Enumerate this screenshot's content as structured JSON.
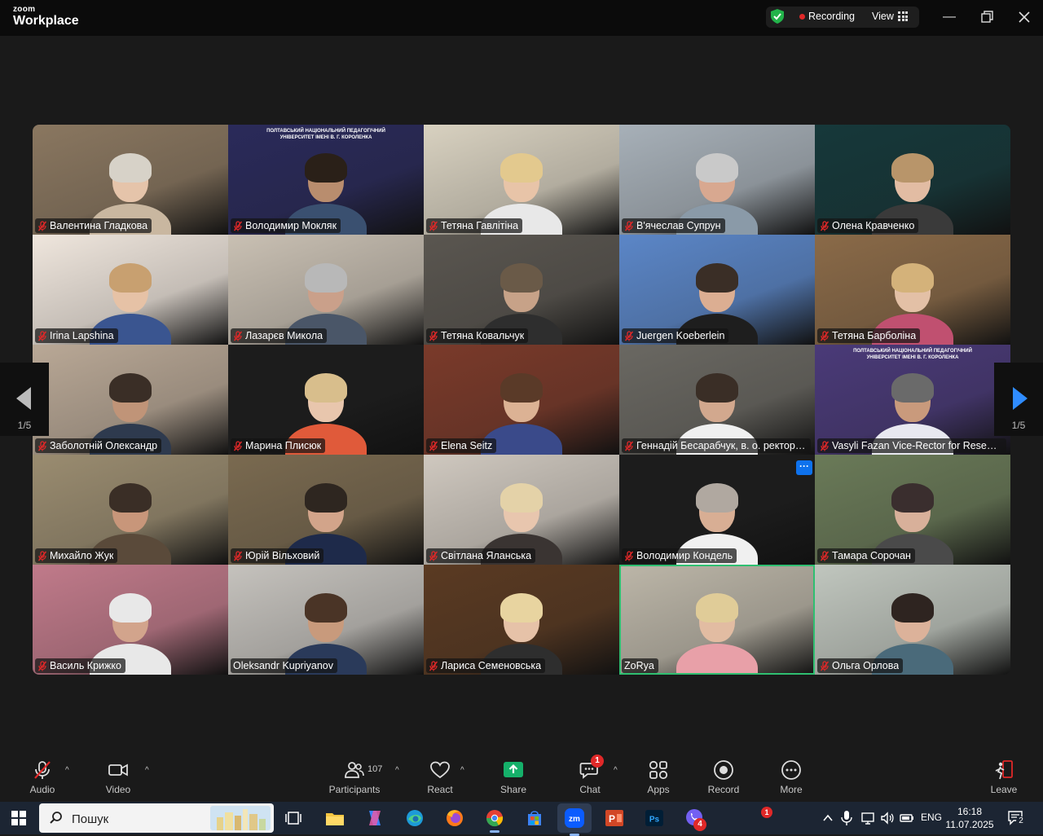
{
  "titlebar": {
    "brand_small": "zoom",
    "brand_big": "Workplace",
    "recording_label": "Recording",
    "view_label": "View"
  },
  "pager": {
    "left_page": "1/5",
    "right_page": "1/5"
  },
  "participants": [
    {
      "name": "Валентина Гладкова",
      "bg": "#8a7760",
      "skin": "#e5c4aa",
      "hair": "#d7d2c8",
      "shirt": "#c9b7a0",
      "muted": true
    },
    {
      "name": "Володимир Мокляк",
      "bg": "#2a2a5a",
      "skin": "#b98d6e",
      "hair": "#2a2018",
      "shirt": "#3a5070",
      "muted": true,
      "banner_line1": "ПОЛТАВСЬКИЙ НАЦІОНАЛЬНИЙ ПЕДАГОГІЧНИЙ",
      "banner_line2": "УНІВЕРСИТЕТ ІМЕНІ В. Г. КОРОЛЕНКА"
    },
    {
      "name": "Тетяна Гавлітіна",
      "bg": "#d8d1c0",
      "skin": "#e8c4a8",
      "hair": "#e3c98e",
      "shirt": "#e8e8e8",
      "muted": true
    },
    {
      "name": "В'ячеслав Супрун",
      "bg": "#a7b0b8",
      "skin": "#d8a890",
      "hair": "#c9c9c9",
      "shirt": "#8a9aa8",
      "muted": true
    },
    {
      "name": "Олена Кравченко",
      "bg": "#16383a",
      "skin": "#e2bca3",
      "hair": "#b8956a",
      "shirt": "#3a3a3a",
      "muted": true
    },
    {
      "name": "Irina Lapshina",
      "bg": "#efe6dd",
      "skin": "#e6c2a6",
      "hair": "#c8a070",
      "shirt": "#3a5590",
      "muted": true
    },
    {
      "name": "Лазарєв Микола",
      "bg": "#c9c0b3",
      "skin": "#caa08a",
      "hair": "#b8b8b8",
      "shirt": "#4a5668",
      "muted": true
    },
    {
      "name": "Тетяна Ковальчук",
      "bg": "#5a5650",
      "skin": "#c7a288",
      "hair": "#6a5a48",
      "shirt": "#2e2e2e",
      "muted": true
    },
    {
      "name": "Juergen Koeberlein",
      "bg": "#5b86c7",
      "skin": "#dcae92",
      "hair": "#3a2e26",
      "shirt": "#1e1e1e",
      "muted": true
    },
    {
      "name": "Тетяна Барболіна",
      "bg": "#8a6a48",
      "skin": "#e3c0a6",
      "hair": "#d4b27a",
      "shirt": "#c05070",
      "muted": true
    },
    {
      "name": "Заболотній Олександр",
      "bg": "#b9a896",
      "skin": "#c09478",
      "hair": "#3a2e26",
      "shirt": "#2e3a4e",
      "muted": true
    },
    {
      "name": "Марина Плисюк",
      "bg": "#1c1c1c",
      "skin": "#e8c6ad",
      "hair": "#d8be8c",
      "shirt": "#e05a3a",
      "muted": true
    },
    {
      "name": "Elena Seitz",
      "bg": "#7a3a2a",
      "skin": "#dcb294",
      "hair": "#5a3a28",
      "shirt": "#3a4a8a",
      "muted": true
    },
    {
      "name": "Геннадій Бесарабчук, в. о. ректора ПНПУ",
      "bg": "#6a6862",
      "skin": "#d2a88e",
      "hair": "#3a2e26",
      "shirt": "#f0f0f0",
      "muted": true
    },
    {
      "name": "Vasyli Fazan Vice-Rector for Research",
      "bg": "#4a3a78",
      "skin": "#c99a7c",
      "hair": "#6a6a6a",
      "shirt": "#e8e8f0",
      "muted": true,
      "banner_line1": "ПОЛТАВСЬКИЙ НАЦІОНАЛЬНИЙ ПЕДАГОГІЧНИЙ",
      "banner_line2": "УНІВЕРСИТЕТ ІМЕНІ В. Г. КОРОЛЕНКА"
    },
    {
      "name": "Михайло Жук",
      "bg": "#9a8c70",
      "skin": "#c8967a",
      "hair": "#3a2e26",
      "shirt": "#5a4a3a",
      "muted": true
    },
    {
      "name": "Юрій Вільховий",
      "bg": "#7a6a50",
      "skin": "#d2a48a",
      "hair": "#2e2620",
      "shirt": "#1e2a4a",
      "muted": true
    },
    {
      "name": "Світлана  Яланська",
      "bg": "#cfc8bf",
      "skin": "#e8c6ae",
      "hair": "#e4d2a8",
      "shirt": "#3a3432",
      "muted": true
    },
    {
      "name": "Володимир Кондель",
      "bg": "#1c1c1c",
      "skin": "#d8ae94",
      "hair": "#b0a8a0",
      "shirt": "#f0f0f0",
      "muted": true,
      "more_label": "···"
    },
    {
      "name": "Тамара Сорочан",
      "bg": "#6a7a58",
      "skin": "#d8b09a",
      "hair": "#3a2e2e",
      "shirt": "#4a4a4a",
      "muted": true
    },
    {
      "name": "Василь Крижко",
      "bg": "#c07a8a",
      "skin": "#d2a48c",
      "hair": "#e8e8e8",
      "shirt": "#e8e8e8",
      "muted": true
    },
    {
      "name": "Oleksandr Kupriyanov",
      "bg": "#c5c2bd",
      "skin": "#c89a7c",
      "hair": "#4a3426",
      "shirt": "#2a3a5a",
      "muted": false
    },
    {
      "name": "Лариса Семеновська",
      "bg": "#5a3a22",
      "skin": "#e6c2a8",
      "hair": "#e8d4a0",
      "shirt": "#2e2e2e",
      "muted": true
    },
    {
      "name": "ZoRya",
      "bg": "#bcb6a8",
      "skin": "#e2bca2",
      "hair": "#e0cc98",
      "shirt": "#e8a0a8",
      "muted": false,
      "active": true
    },
    {
      "name": "Ольга Орлова",
      "bg": "#c0c6be",
      "skin": "#dcb29a",
      "hair": "#2e2420",
      "shirt": "#4a6a7a",
      "muted": true
    }
  ],
  "controls": {
    "audio": "Audio",
    "video": "Video",
    "participants": "Participants",
    "participants_count": "107",
    "react": "React",
    "share": "Share",
    "chat": "Chat",
    "chat_badge": "1",
    "apps": "Apps",
    "record": "Record",
    "more": "More",
    "leave": "Leave"
  },
  "taskbar": {
    "search_placeholder": "Пошук",
    "viber_badge": "4",
    "tray_badge": "1",
    "lang": "ENG",
    "time": "16:18",
    "date": "11.07.2025",
    "notif_count": "2"
  },
  "colors": {
    "accent": "#0e72ed",
    "share_green": "#15b06a",
    "active_speaker": "#2fbf71",
    "muted_red": "#e02828"
  }
}
